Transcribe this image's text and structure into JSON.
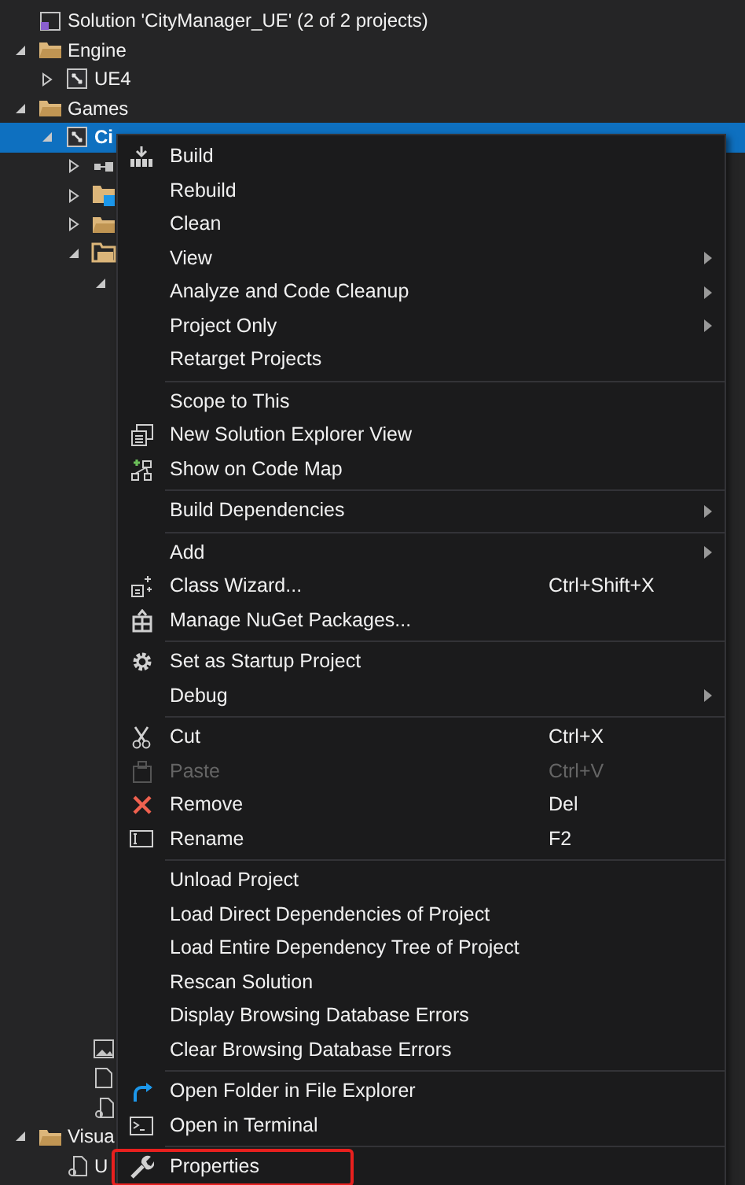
{
  "tree": [
    {
      "label": "Solution 'CityManager_UE' (2 of 2 projects)",
      "kind": "solution",
      "selected": false,
      "children": [
        {
          "label": "Engine",
          "kind": "folder",
          "expanded": true,
          "selected": false,
          "children": [
            {
              "label": "UE4",
              "kind": "project",
              "expanded": false,
              "selected": false
            }
          ]
        },
        {
          "label": "Games",
          "kind": "folder",
          "expanded": true,
          "selected": false,
          "children": [
            {
              "label": "Ci",
              "kind": "project",
              "expanded": true,
              "selected": true,
              "children": [
                {
                  "kind": "references",
                  "expanded": false,
                  "selected": false
                },
                {
                  "kind": "external",
                  "expanded": false,
                  "selected": false
                },
                {
                  "kind": "folder",
                  "expanded": false,
                  "selected": false
                },
                {
                  "kind": "filter",
                  "expanded": true,
                  "selected": false,
                  "children": [
                    {
                      "expanded": true,
                      "selected": false
                    }
                  ]
                },
                {
                  "kind": "image",
                  "selected": false
                },
                {
                  "kind": "file",
                  "selected": false
                },
                {
                  "kind": "filelink",
                  "selected": false
                }
              ]
            }
          ]
        },
        {
          "label": "Visua",
          "kind": "folder",
          "expanded": true,
          "selected": false,
          "children": [
            {
              "label": "U",
              "kind": "filelink",
              "selected": false
            }
          ]
        }
      ]
    }
  ],
  "menu": [
    {
      "kind": "item",
      "label": "Build"
    },
    {
      "kind": "item",
      "label": "Rebuild"
    },
    {
      "kind": "item",
      "label": "Clean"
    },
    {
      "kind": "item",
      "label": "View",
      "submenu": true
    },
    {
      "kind": "item",
      "label": "Analyze and Code Cleanup",
      "submenu": true
    },
    {
      "kind": "item",
      "label": "Project Only",
      "submenu": true
    },
    {
      "kind": "item",
      "label": "Retarget Projects"
    },
    {
      "kind": "separator"
    },
    {
      "kind": "item",
      "label": "Scope to This"
    },
    {
      "kind": "item",
      "label": "New Solution Explorer View"
    },
    {
      "kind": "item",
      "label": "Show on Code Map"
    },
    {
      "kind": "separator"
    },
    {
      "kind": "item",
      "label": "Build Dependencies",
      "submenu": true
    },
    {
      "kind": "separator"
    },
    {
      "kind": "item",
      "label": "Add",
      "submenu": true
    },
    {
      "kind": "item",
      "label": "Class Wizard...",
      "shortcut": "Ctrl+Shift+X"
    },
    {
      "kind": "item",
      "label": "Manage NuGet Packages..."
    },
    {
      "kind": "separator"
    },
    {
      "kind": "item",
      "label": "Set as Startup Project"
    },
    {
      "kind": "item",
      "label": "Debug",
      "submenu": true
    },
    {
      "kind": "separator"
    },
    {
      "kind": "item",
      "label": "Cut",
      "shortcut": "Ctrl+X"
    },
    {
      "kind": "item",
      "label": "Paste",
      "shortcut": "Ctrl+V",
      "disabled": true
    },
    {
      "kind": "item",
      "label": "Remove",
      "shortcut": "Del"
    },
    {
      "kind": "item",
      "label": "Rename",
      "shortcut": "F2"
    },
    {
      "kind": "separator"
    },
    {
      "kind": "item",
      "label": "Unload Project"
    },
    {
      "kind": "item",
      "label": "Load Direct Dependencies of Project"
    },
    {
      "kind": "item",
      "label": "Load Entire Dependency Tree of Project"
    },
    {
      "kind": "item",
      "label": "Rescan Solution"
    },
    {
      "kind": "item",
      "label": "Display Browsing Database Errors"
    },
    {
      "kind": "item",
      "label": "Clear Browsing Database Errors"
    },
    {
      "kind": "separator"
    },
    {
      "kind": "item",
      "label": "Open Folder in File Explorer"
    },
    {
      "kind": "item",
      "label": "Open in Terminal"
    },
    {
      "kind": "separator"
    },
    {
      "kind": "item",
      "label": "Properties",
      "highlighted": true
    }
  ]
}
